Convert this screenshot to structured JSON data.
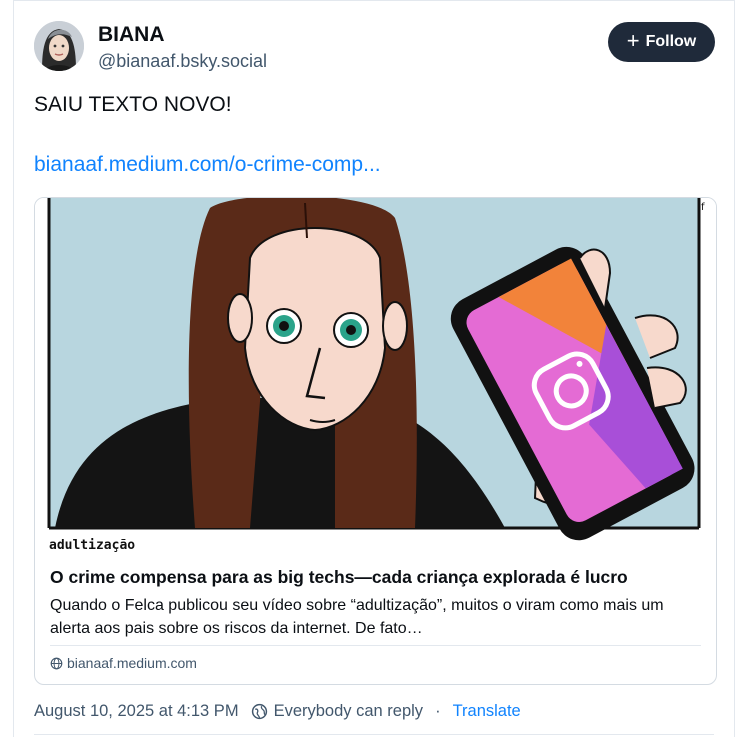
{
  "author": {
    "display_name": "BIANA",
    "handle": "@bianaaf.bsky.social"
  },
  "follow_button": {
    "label": "Follow",
    "icon": "plus-icon"
  },
  "post": {
    "text": "SAIU TEXTO NOVO!",
    "link_text": "bianaaf.medium.com/o-crime-comp..."
  },
  "link_card": {
    "image_caption": "adultização",
    "title": "O crime compensa para as big techs—cada criança explorada é lucro",
    "description": "Quando o Felca publicou seu vídeo sobre “adultização”, muitos o viram como mais um alerta aos pais sobre os riscos da internet. De fato…",
    "domain": "bianaaf.medium.com",
    "domain_icon": "globe-icon"
  },
  "meta": {
    "timestamp": "August 10, 2025 at 4:13 PM",
    "reply_setting": "Everybody can reply",
    "separator": "·",
    "translate": "Translate"
  },
  "colors": {
    "link": "#1083fe",
    "follow_bg": "#1f2a3a",
    "muted": "#42576c"
  }
}
